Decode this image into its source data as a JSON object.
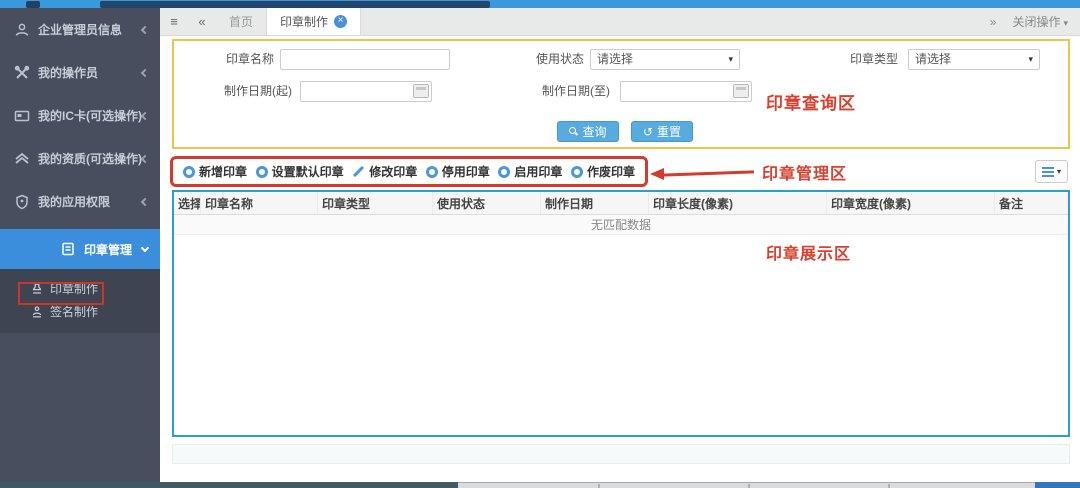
{
  "icons": {
    "menu": "≡",
    "collapse": "«",
    "expand": "»",
    "caret": "▾",
    "close": "×",
    "reset": "↺"
  },
  "tabbar": {
    "tabs": [
      {
        "label": "首页"
      },
      {
        "label": "印章制作"
      }
    ],
    "close_ops_label": "关闭操作"
  },
  "sidebar": {
    "items": [
      {
        "label": "企业管理员信息",
        "icon": "user-icon"
      },
      {
        "label": "我的操作员",
        "icon": "tools-icon"
      },
      {
        "label": "我的IC卡(可选操作)",
        "icon": "ic-card-icon"
      },
      {
        "label": "我的资质(可选操作)",
        "icon": "qualification-icon"
      },
      {
        "label": "我的应用权限",
        "icon": "shield-icon"
      },
      {
        "label": "印章管理",
        "icon": "seal-manage-icon"
      }
    ],
    "subitems": [
      {
        "label": "印章制作",
        "icon": "stamp-icon"
      },
      {
        "label": "签名制作",
        "icon": "signature-stamp-icon"
      }
    ]
  },
  "query": {
    "seal_name_label": "印章名称",
    "seal_name_value": "",
    "use_status_label": "使用状态",
    "use_status_value": "请选择",
    "seal_type_label": "印章类型",
    "seal_type_value": "请选择",
    "date_from_label": "制作日期(起)",
    "date_from_value": "",
    "date_to_label": "制作日期(至)",
    "date_to_value": "",
    "search_label": "查询",
    "reset_label": "重置",
    "annotation": "印章查询区"
  },
  "toolbar": {
    "buttons": [
      {
        "label": "新增印章",
        "icon": "add-circle-icon"
      },
      {
        "label": "设置默认印章",
        "icon": "default-circle-icon"
      },
      {
        "label": "修改印章",
        "icon": "pencil-icon"
      },
      {
        "label": "停用印章",
        "icon": "stop-circle-icon"
      },
      {
        "label": "启用印章",
        "icon": "enable-circle-icon"
      },
      {
        "label": "作废印章",
        "icon": "void-circle-icon"
      }
    ],
    "annotation": "印章管理区"
  },
  "table": {
    "columns": [
      "选择",
      "印章名称",
      "印章类型",
      "使用状态",
      "制作日期",
      "印章长度(像素)",
      "印章宽度(像素)",
      "备注"
    ],
    "empty_text": "无匹配数据",
    "annotation": "印章展示区"
  },
  "colors": {
    "topbar_blue": "#3a99dc",
    "sidebar_bg": "#484e5e",
    "sidebar_active_blue": "#3a8edb",
    "annotation_red": "#d8412f",
    "query_border_yellow": "#f3c24d",
    "table_border_blue": "#2b9fc9",
    "button_blue": "#58abdf",
    "icon_blue": "#4a97d9"
  }
}
